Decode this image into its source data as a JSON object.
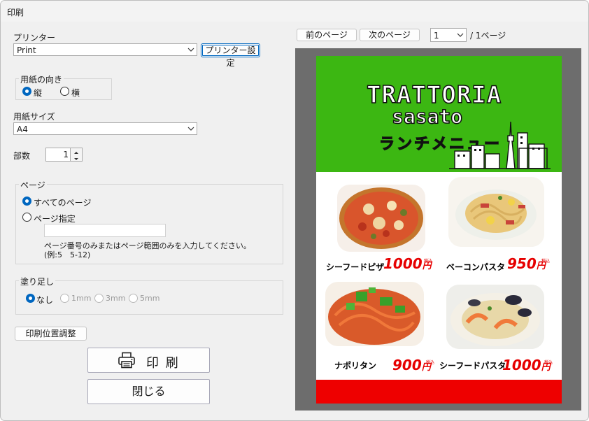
{
  "window": {
    "title": "印刷"
  },
  "printer": {
    "label": "プリンター",
    "selected": "Print",
    "settings_button": "プリンター設定"
  },
  "orientation": {
    "legend": "用紙の向き",
    "portrait": "縦",
    "landscape": "横",
    "selected": "portrait"
  },
  "paper_size": {
    "label": "用紙サイズ",
    "selected": "A4"
  },
  "copies": {
    "label": "部数",
    "value": "1"
  },
  "pages": {
    "legend": "ページ",
    "all_label": "すべてのページ",
    "specify_label": "ページ指定",
    "range_value": "",
    "hint_line1": "ページ番号のみまたはページ範囲のみを入力してください。",
    "hint_line2": "(例:5　5-12)"
  },
  "bleed": {
    "legend": "塗り足し",
    "options": [
      "なし",
      "1mm",
      "3mm",
      "5mm"
    ],
    "selected": "なし"
  },
  "buttons": {
    "position_adjust": "印刷位置調整",
    "print": "印 刷",
    "close": "閉じる"
  },
  "preview_nav": {
    "prev": "前のページ",
    "next": "次のページ",
    "current_page": "1",
    "total": "/ 1ページ"
  },
  "menu_page": {
    "title_line1": "TRATTORIA",
    "title_line2": "sasato",
    "subtitle": "ランチメニュー",
    "header_color": "#3cb712",
    "footer_color": "#ee0000",
    "price_color": "#e60000",
    "yen": "円",
    "tax": "税込",
    "dishes": [
      {
        "name": "シーフードピザ",
        "price": "1000"
      },
      {
        "name": "ベーコンパスタ",
        "price": "950"
      },
      {
        "name": "ナポリタン",
        "price": "900"
      },
      {
        "name": "シーフードパスタ",
        "price": "1000"
      }
    ]
  }
}
